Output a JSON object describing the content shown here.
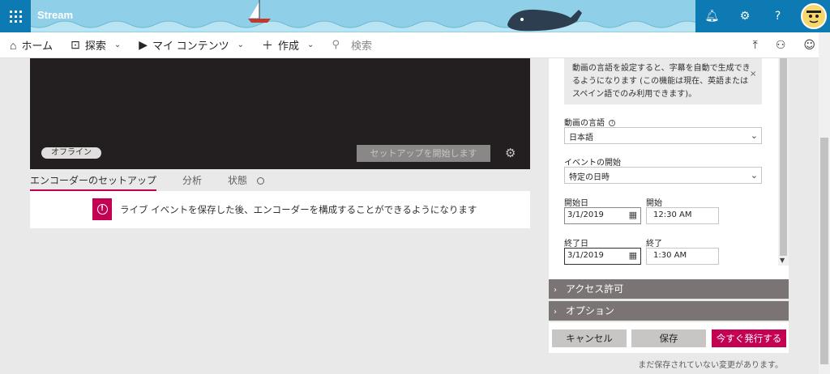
{
  "header": {
    "brand": "Stream",
    "icons": [
      "bell-icon",
      "gear-icon",
      "help-icon"
    ]
  },
  "nav": {
    "home": "ホーム",
    "discover": "探索",
    "my_content": "マイ コンテンツ",
    "create": "作成",
    "search_placeholder": "検索"
  },
  "video": {
    "status_badge": "オフライン",
    "setup_button": "セットアップを開始します"
  },
  "tabs": [
    {
      "label": "エンコーダーのセットアップ"
    },
    {
      "label": "分析"
    },
    {
      "label": "状態"
    }
  ],
  "info_message": "ライブ イベントを保存した後、エンコーダーを構成することができるようになります",
  "right_panel": {
    "note": "動画の言語を設定すると、字幕を自動で生成できるようになります (この機能は現在、英語またはスペイン語でのみ利用できます)。",
    "note_close": "×",
    "language_label": "動画の言語",
    "language_value": "日本語",
    "event_start_label": "イベントの開始",
    "event_start_value": "特定の日時",
    "start_date_label": "開始日",
    "start_date_value": "3/1/2019",
    "start_time_label": "開始",
    "start_time_value": "12:30 AM",
    "end_date_label": "終了日",
    "end_date_value": "3/1/2019",
    "end_time_label": "終了",
    "end_time_value": "1:30 AM"
  },
  "accordions": {
    "access": "アクセス許可",
    "options": "オプション"
  },
  "buttons": {
    "cancel": "キャンセル",
    "save": "保存",
    "publish": "今すぐ発行する"
  },
  "unsaved_text": "まだ保存されていない変更があります。",
  "colors": {
    "accent": "#c30052",
    "header_blue": "#0e7ab3",
    "sky": "#8fd0e8"
  }
}
